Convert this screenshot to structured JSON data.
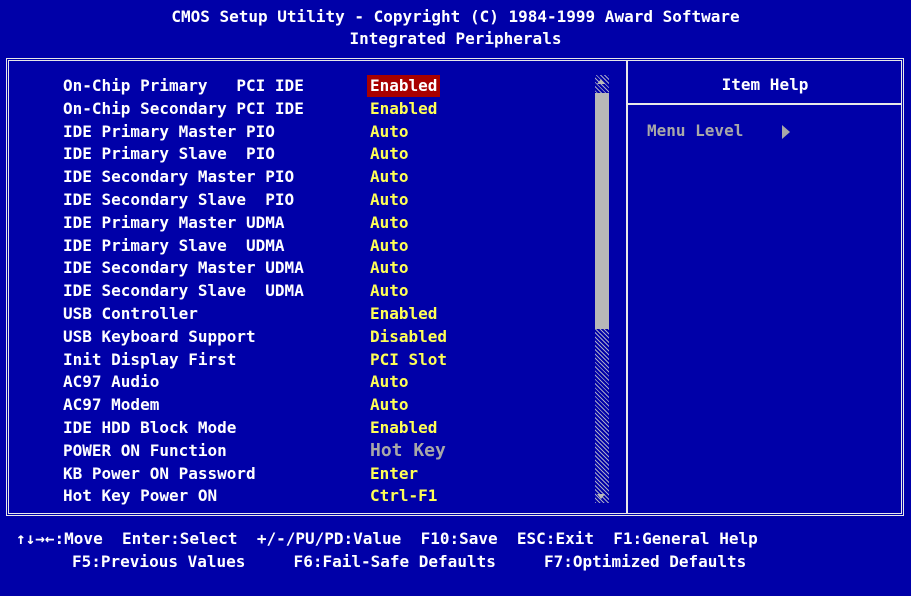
{
  "header": {
    "title": "CMOS Setup Utility - Copyright (C) 1984-1999 Award Software",
    "subtitle": "Integrated Peripherals"
  },
  "settings": [
    {
      "label": "On-Chip Primary   PCI IDE",
      "value": "Enabled",
      "state": "selected"
    },
    {
      "label": "On-Chip Secondary PCI IDE",
      "value": "Enabled"
    },
    {
      "label": "IDE Primary Master PIO",
      "value": "Auto"
    },
    {
      "label": "IDE Primary Slave  PIO",
      "value": "Auto"
    },
    {
      "label": "IDE Secondary Master PIO",
      "value": "Auto"
    },
    {
      "label": "IDE Secondary Slave  PIO",
      "value": "Auto"
    },
    {
      "label": "IDE Primary Master UDMA",
      "value": "Auto"
    },
    {
      "label": "IDE Primary Slave  UDMA",
      "value": "Auto"
    },
    {
      "label": "IDE Secondary Master UDMA",
      "value": "Auto"
    },
    {
      "label": "IDE Secondary Slave  UDMA",
      "value": "Auto"
    },
    {
      "label": "USB Controller",
      "value": "Enabled"
    },
    {
      "label": "USB Keyboard Support",
      "value": "Disabled"
    },
    {
      "label": "Init Display First",
      "value": "PCI Slot"
    },
    {
      "label": "AC97 Audio",
      "value": "Auto"
    },
    {
      "label": "AC97 Modem",
      "value": "Auto"
    },
    {
      "label": "IDE HDD Block Mode",
      "value": "Enabled"
    },
    {
      "label": "POWER ON Function",
      "value": "Hot Key",
      "state": "disabled"
    },
    {
      "label": "KB Power ON Password",
      "value": "Enter"
    },
    {
      "label": "Hot Key Power ON",
      "value": "Ctrl-F1"
    }
  ],
  "help": {
    "title": "Item Help",
    "menu_level": "Menu Level"
  },
  "footer": {
    "line1": "↑↓→←:Move  Enter:Select  +/-/PU/PD:Value  F10:Save  ESC:Exit  F1:General Help",
    "line2": "F5:Previous Values     F6:Fail-Safe Defaults     F7:Optimized Defaults"
  },
  "colors": {
    "background": "#0000a8",
    "value": "#ffff55",
    "selected_bg": "#a80000",
    "disabled": "#a8a8a8"
  },
  "icons": {
    "scroll_up": "arrow-up-icon",
    "scroll_down": "arrow-down-icon",
    "menu_level": "triangle-right-icon"
  }
}
